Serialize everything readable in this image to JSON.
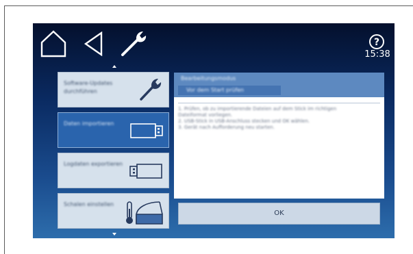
{
  "header": {
    "clock": "15:38",
    "icons": [
      "home-icon",
      "back-icon",
      "wrench-icon",
      "help-icon"
    ]
  },
  "menu": {
    "items": [
      {
        "label": "Software-Updates durchführen",
        "icon": "wrench-icon",
        "state": "default"
      },
      {
        "label": "Daten importieren",
        "icon": "usb-stick-icon",
        "state": "selected"
      },
      {
        "label": "Logdaten exportieren",
        "icon": "usb-stick-icon",
        "state": "default"
      },
      {
        "label": "Schalen einstellen",
        "icon": "thermometer-bowl-icon",
        "state": "default"
      }
    ]
  },
  "dialog": {
    "title": "Bearbeitungsmodus",
    "subtitle": "Vor dem Start prüfen",
    "lines": [
      "1. Prüfen, ob zu importierende Dateien auf dem Stick im richtigen",
      "Dateiformat vorliegen.",
      "2. USB-Stick in USB-Anschluss stecken und OK wählen.",
      "3. Gerät nach Aufforderung neu starten."
    ],
    "ok_label": "OK"
  },
  "colors": {
    "screen_top": "#04102d",
    "screen_bottom": "#2d6dac",
    "selected_item": "#2a64ad",
    "panel_header": "#5d89c0"
  }
}
